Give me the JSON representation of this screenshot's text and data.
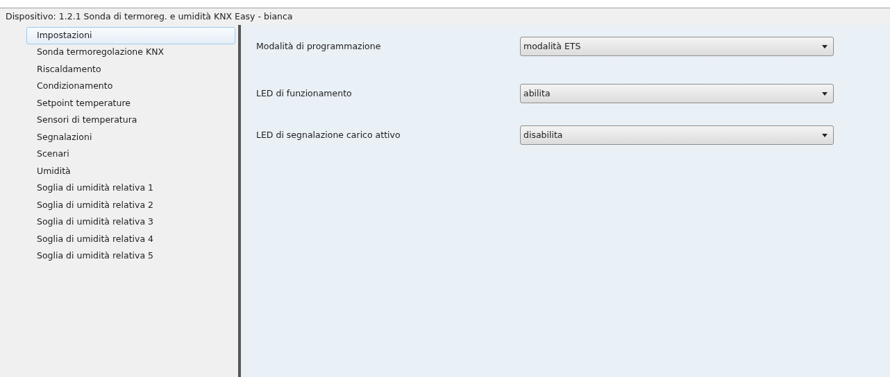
{
  "window": {
    "title": "Dispositivo: 1.2.1  Sonda di termoreg. e umidità KNX Easy - bianca"
  },
  "sidebar": {
    "items": [
      {
        "label": "Impostazioni",
        "selected": true
      },
      {
        "label": "Sonda termoregolazione KNX",
        "selected": false
      },
      {
        "label": "Riscaldamento",
        "selected": false
      },
      {
        "label": "Condizionamento",
        "selected": false
      },
      {
        "label": "Setpoint temperature",
        "selected": false
      },
      {
        "label": "Sensori di temperatura",
        "selected": false
      },
      {
        "label": "Segnalazioni",
        "selected": false
      },
      {
        "label": "Scenari",
        "selected": false
      },
      {
        "label": "Umidità",
        "selected": false
      },
      {
        "label": "Soglia di umidità relativa 1",
        "selected": false
      },
      {
        "label": "Soglia di umidità relativa 2",
        "selected": false
      },
      {
        "label": "Soglia di umidità relativa 3",
        "selected": false
      },
      {
        "label": "Soglia di umidità relativa 4",
        "selected": false
      },
      {
        "label": "Soglia di umidità relativa 5",
        "selected": false
      }
    ]
  },
  "parameter_groups": [
    [
      {
        "label": "Modalità di programmazione",
        "value": "modalità ETS"
      }
    ],
    [
      {
        "label": "LED di funzionamento",
        "value": "abilita"
      },
      {
        "label": "LED di segnalazione carico attivo",
        "value": "disabilita"
      }
    ]
  ]
}
